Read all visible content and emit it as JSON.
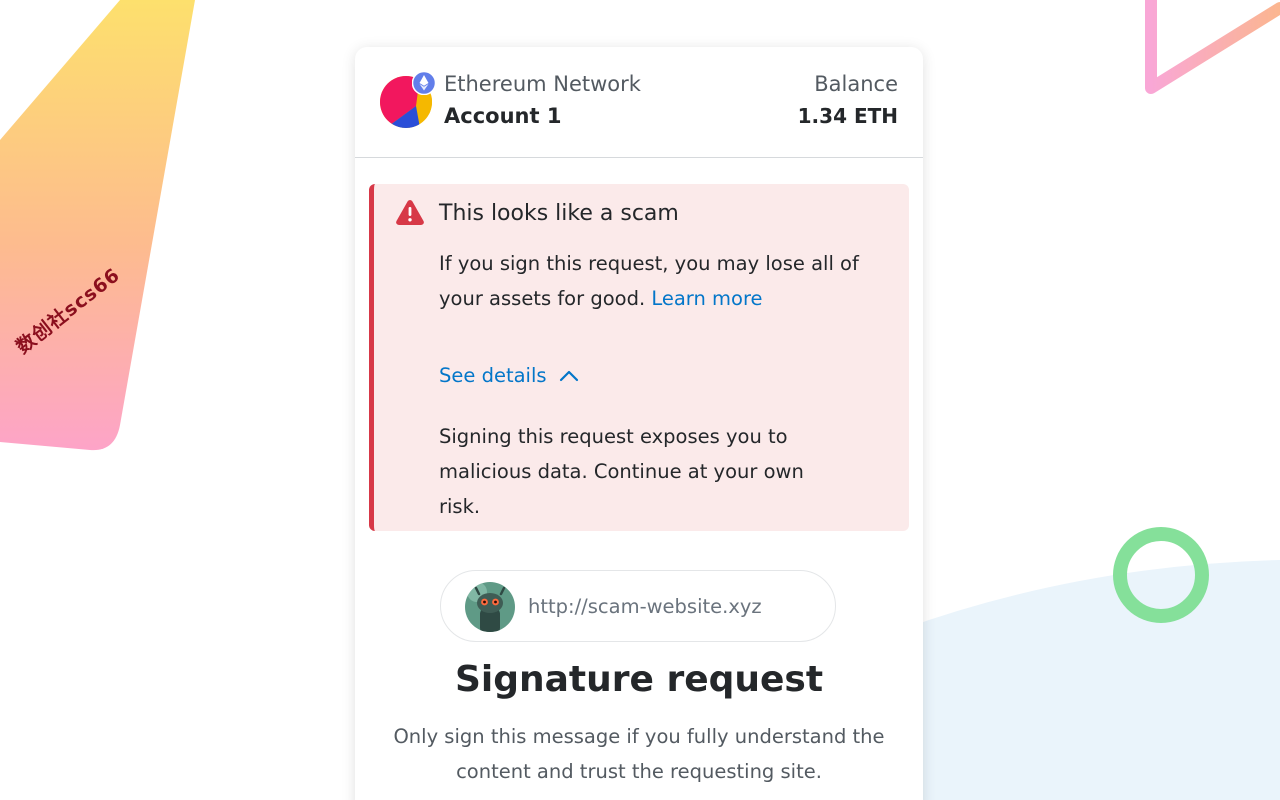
{
  "header": {
    "network_name": "Ethereum Network",
    "account_name": "Account 1",
    "balance_label": "Balance",
    "balance_value": "1.34 ETH"
  },
  "alert": {
    "title": "This looks like a scam",
    "body": "If you sign this request, you may lose all of your assets for good.",
    "learn_more": "Learn more",
    "see_details": "See details",
    "details": "Signing this request exposes you to malicious data. Continue at your own risk.",
    "icon": "warning-triangle-icon"
  },
  "origin": {
    "url": "http://scam-website.xyz",
    "icon": "site-avatar"
  },
  "signature": {
    "title": "Signature request",
    "description": "Only sign this message if you fully understand the content and trust the requesting site."
  },
  "decor": {
    "watermark": "数创社scs66"
  },
  "colors": {
    "danger": "#d73847",
    "alert_bg": "#fbeaea",
    "link": "#0376c9",
    "text": "#24272a",
    "muted": "#535a61"
  }
}
